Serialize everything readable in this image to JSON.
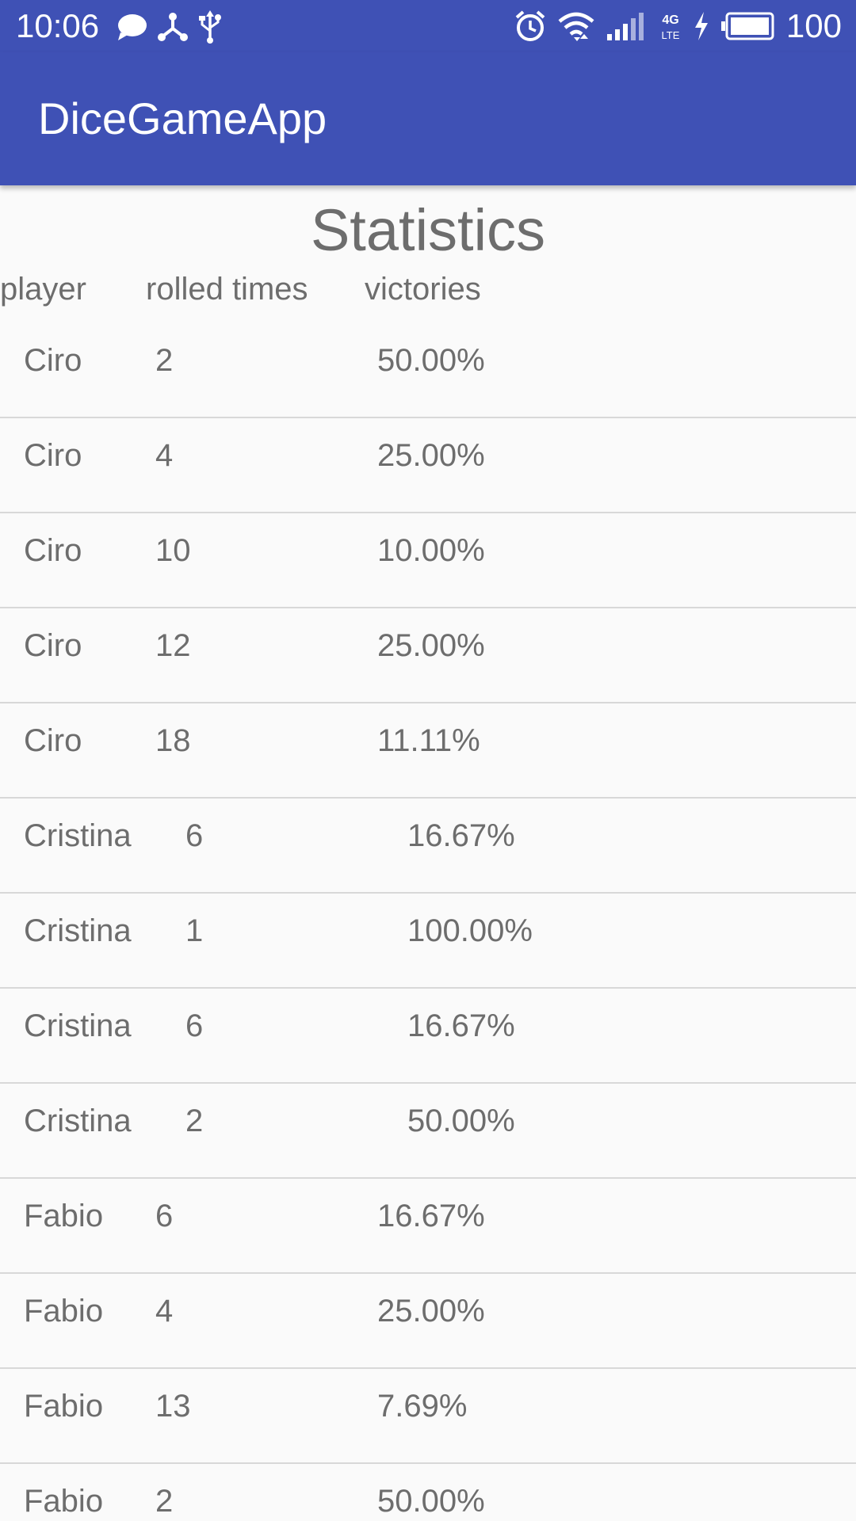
{
  "status_bar": {
    "time": "10:06",
    "battery_level": "100",
    "network_label_top": "4G",
    "network_label_bottom": "LTE",
    "icons_left": [
      "chat-bubble-icon",
      "share-nodes-icon",
      "usb-icon"
    ],
    "icons_right": [
      "alarm-clock-icon",
      "wifi-icon",
      "signal-bars-icon",
      "network-4g-lte-icon",
      "charging-bolt-icon",
      "battery-icon"
    ]
  },
  "app_bar": {
    "title": "DiceGameApp",
    "color": "#3f51b5"
  },
  "statistics": {
    "title": "Statistics",
    "headers": {
      "player": "player",
      "rolled_times": "rolled times",
      "victories": "victories"
    },
    "rows": [
      {
        "player": "Ciro",
        "rolled": "2",
        "victories": "50.00%"
      },
      {
        "player": "Ciro",
        "rolled": "4",
        "victories": "25.00%"
      },
      {
        "player": "Ciro",
        "rolled": "10",
        "victories": "10.00%"
      },
      {
        "player": "Ciro",
        "rolled": "12",
        "victories": "25.00%"
      },
      {
        "player": "Ciro",
        "rolled": "18",
        "victories": "11.11%"
      },
      {
        "player": "Cristina",
        "rolled": "6",
        "victories": "16.67%"
      },
      {
        "player": "Cristina",
        "rolled": "1",
        "victories": "100.00%"
      },
      {
        "player": "Cristina",
        "rolled": "6",
        "victories": "16.67%"
      },
      {
        "player": "Cristina",
        "rolled": "2",
        "victories": "50.00%"
      },
      {
        "player": "Fabio",
        "rolled": "6",
        "victories": "16.67%"
      },
      {
        "player": "Fabio",
        "rolled": "4",
        "victories": "25.00%"
      },
      {
        "player": "Fabio",
        "rolled": "13",
        "victories": "7.69%"
      },
      {
        "player": "Fabio",
        "rolled": "2",
        "victories": "50.00%"
      }
    ]
  }
}
